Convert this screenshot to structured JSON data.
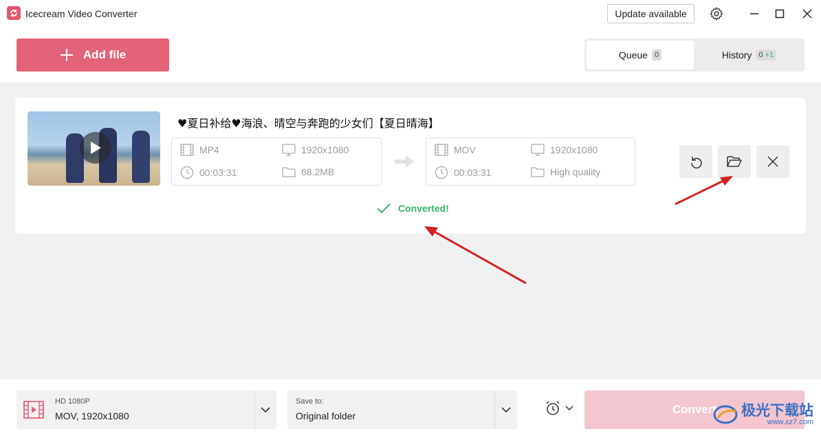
{
  "titlebar": {
    "app_title": "Icecream Video Converter",
    "update_label": "Update available",
    "icons": [
      "settings-gear-icon",
      "minimize-icon",
      "maximize-icon",
      "close-icon"
    ]
  },
  "toolbar": {
    "add_file_label": "Add file",
    "tabs": [
      {
        "label": "Queue",
        "count": "0",
        "active": true
      },
      {
        "label": "History",
        "count": "0",
        "extra": "+1",
        "active": false
      }
    ]
  },
  "item": {
    "title": "♥夏日补给♥海浪、晴空与奔跑的少女们【夏日晴海】",
    "source": {
      "format": "MP4",
      "resolution": "1920x1080",
      "duration": "00:03:31",
      "size": "68.2MB"
    },
    "target": {
      "format": "MOV",
      "resolution": "1920x1080",
      "duration": "00:03:31",
      "quality": "High quality"
    },
    "status": "Converted!",
    "actions": [
      "undo-icon",
      "open-folder-icon",
      "remove-icon"
    ]
  },
  "bottom": {
    "format_label": "HD 1080P",
    "format_value": "MOV, 1920x1080",
    "save_label": "Save to:",
    "save_value": "Original folder",
    "convert_label": "Convert"
  },
  "watermark": {
    "text": "极光下载站",
    "url": "www.xz7.com"
  },
  "colors": {
    "accent": "#e2637a",
    "success": "#3bb36a",
    "annotation": "#d42020"
  }
}
